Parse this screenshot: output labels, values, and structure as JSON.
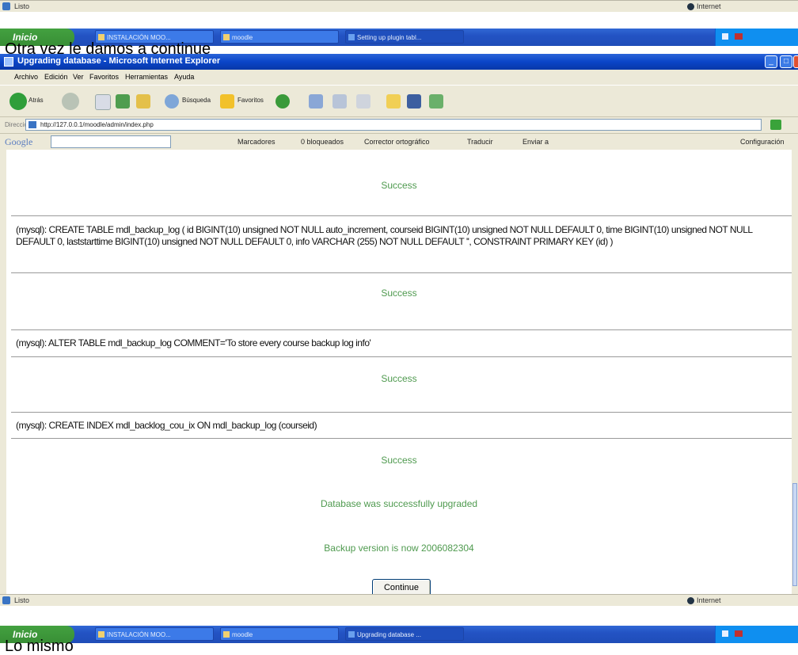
{
  "top_status": {
    "text": "Listo",
    "zone": "Internet"
  },
  "top_taskbar": {
    "start": "Inicio",
    "buttons": [
      "INSTALACIÓN MOO...",
      "moodle",
      "Setting up plugin tabl..."
    ]
  },
  "caption_top": "Otra vez le damos a continue",
  "window": {
    "title": "Upgrading database - Microsoft Internet Explorer",
    "menu": [
      "Archivo",
      "Edición",
      "Ver",
      "Favoritos",
      "Herramientas",
      "Ayuda"
    ],
    "toolbar": {
      "back": "Atrás",
      "search": "Búsqueda",
      "favorites": "Favoritos"
    },
    "address": {
      "label": "Dirección",
      "url": "http://127.0.0.1/moodle/admin/index.php"
    },
    "googlebar": {
      "logo": "Google",
      "items": [
        "Marcadores",
        "0 bloqueados",
        "Corrector ortográfico",
        "Traducir",
        "Enviar a"
      ],
      "settings": "Configuración"
    }
  },
  "content": {
    "success_label": "Success",
    "sql1": "(mysql): CREATE TABLE mdl_backup_log ( id BIGINT(10) unsigned NOT NULL auto_increment, courseid BIGINT(10) unsigned NOT NULL DEFAULT 0, time BIGINT(10) unsigned NOT NULL DEFAULT 0, laststarttime BIGINT(10) unsigned NOT NULL DEFAULT 0, info VARCHAR (255) NOT NULL DEFAULT '', CONSTRAINT PRIMARY KEY (id) )",
    "sql2": "(mysql): ALTER TABLE mdl_backup_log COMMENT='To store every course backup log info'",
    "sql3": "(mysql): CREATE INDEX mdl_backlog_cou_ix ON mdl_backup_log (courseid)",
    "db_upgraded": "Database was successfully upgraded",
    "backup_version": "Backup version is now 2006082304",
    "continue_label": "Continue"
  },
  "bottom_status": {
    "text": "Listo",
    "zone": "Internet"
  },
  "bottom_taskbar": {
    "start": "Inicio",
    "buttons": [
      "INSTALACIÓN MOO...",
      "moodle",
      "Upgrading database ..."
    ]
  },
  "caption_bottom": "Lo mismo"
}
